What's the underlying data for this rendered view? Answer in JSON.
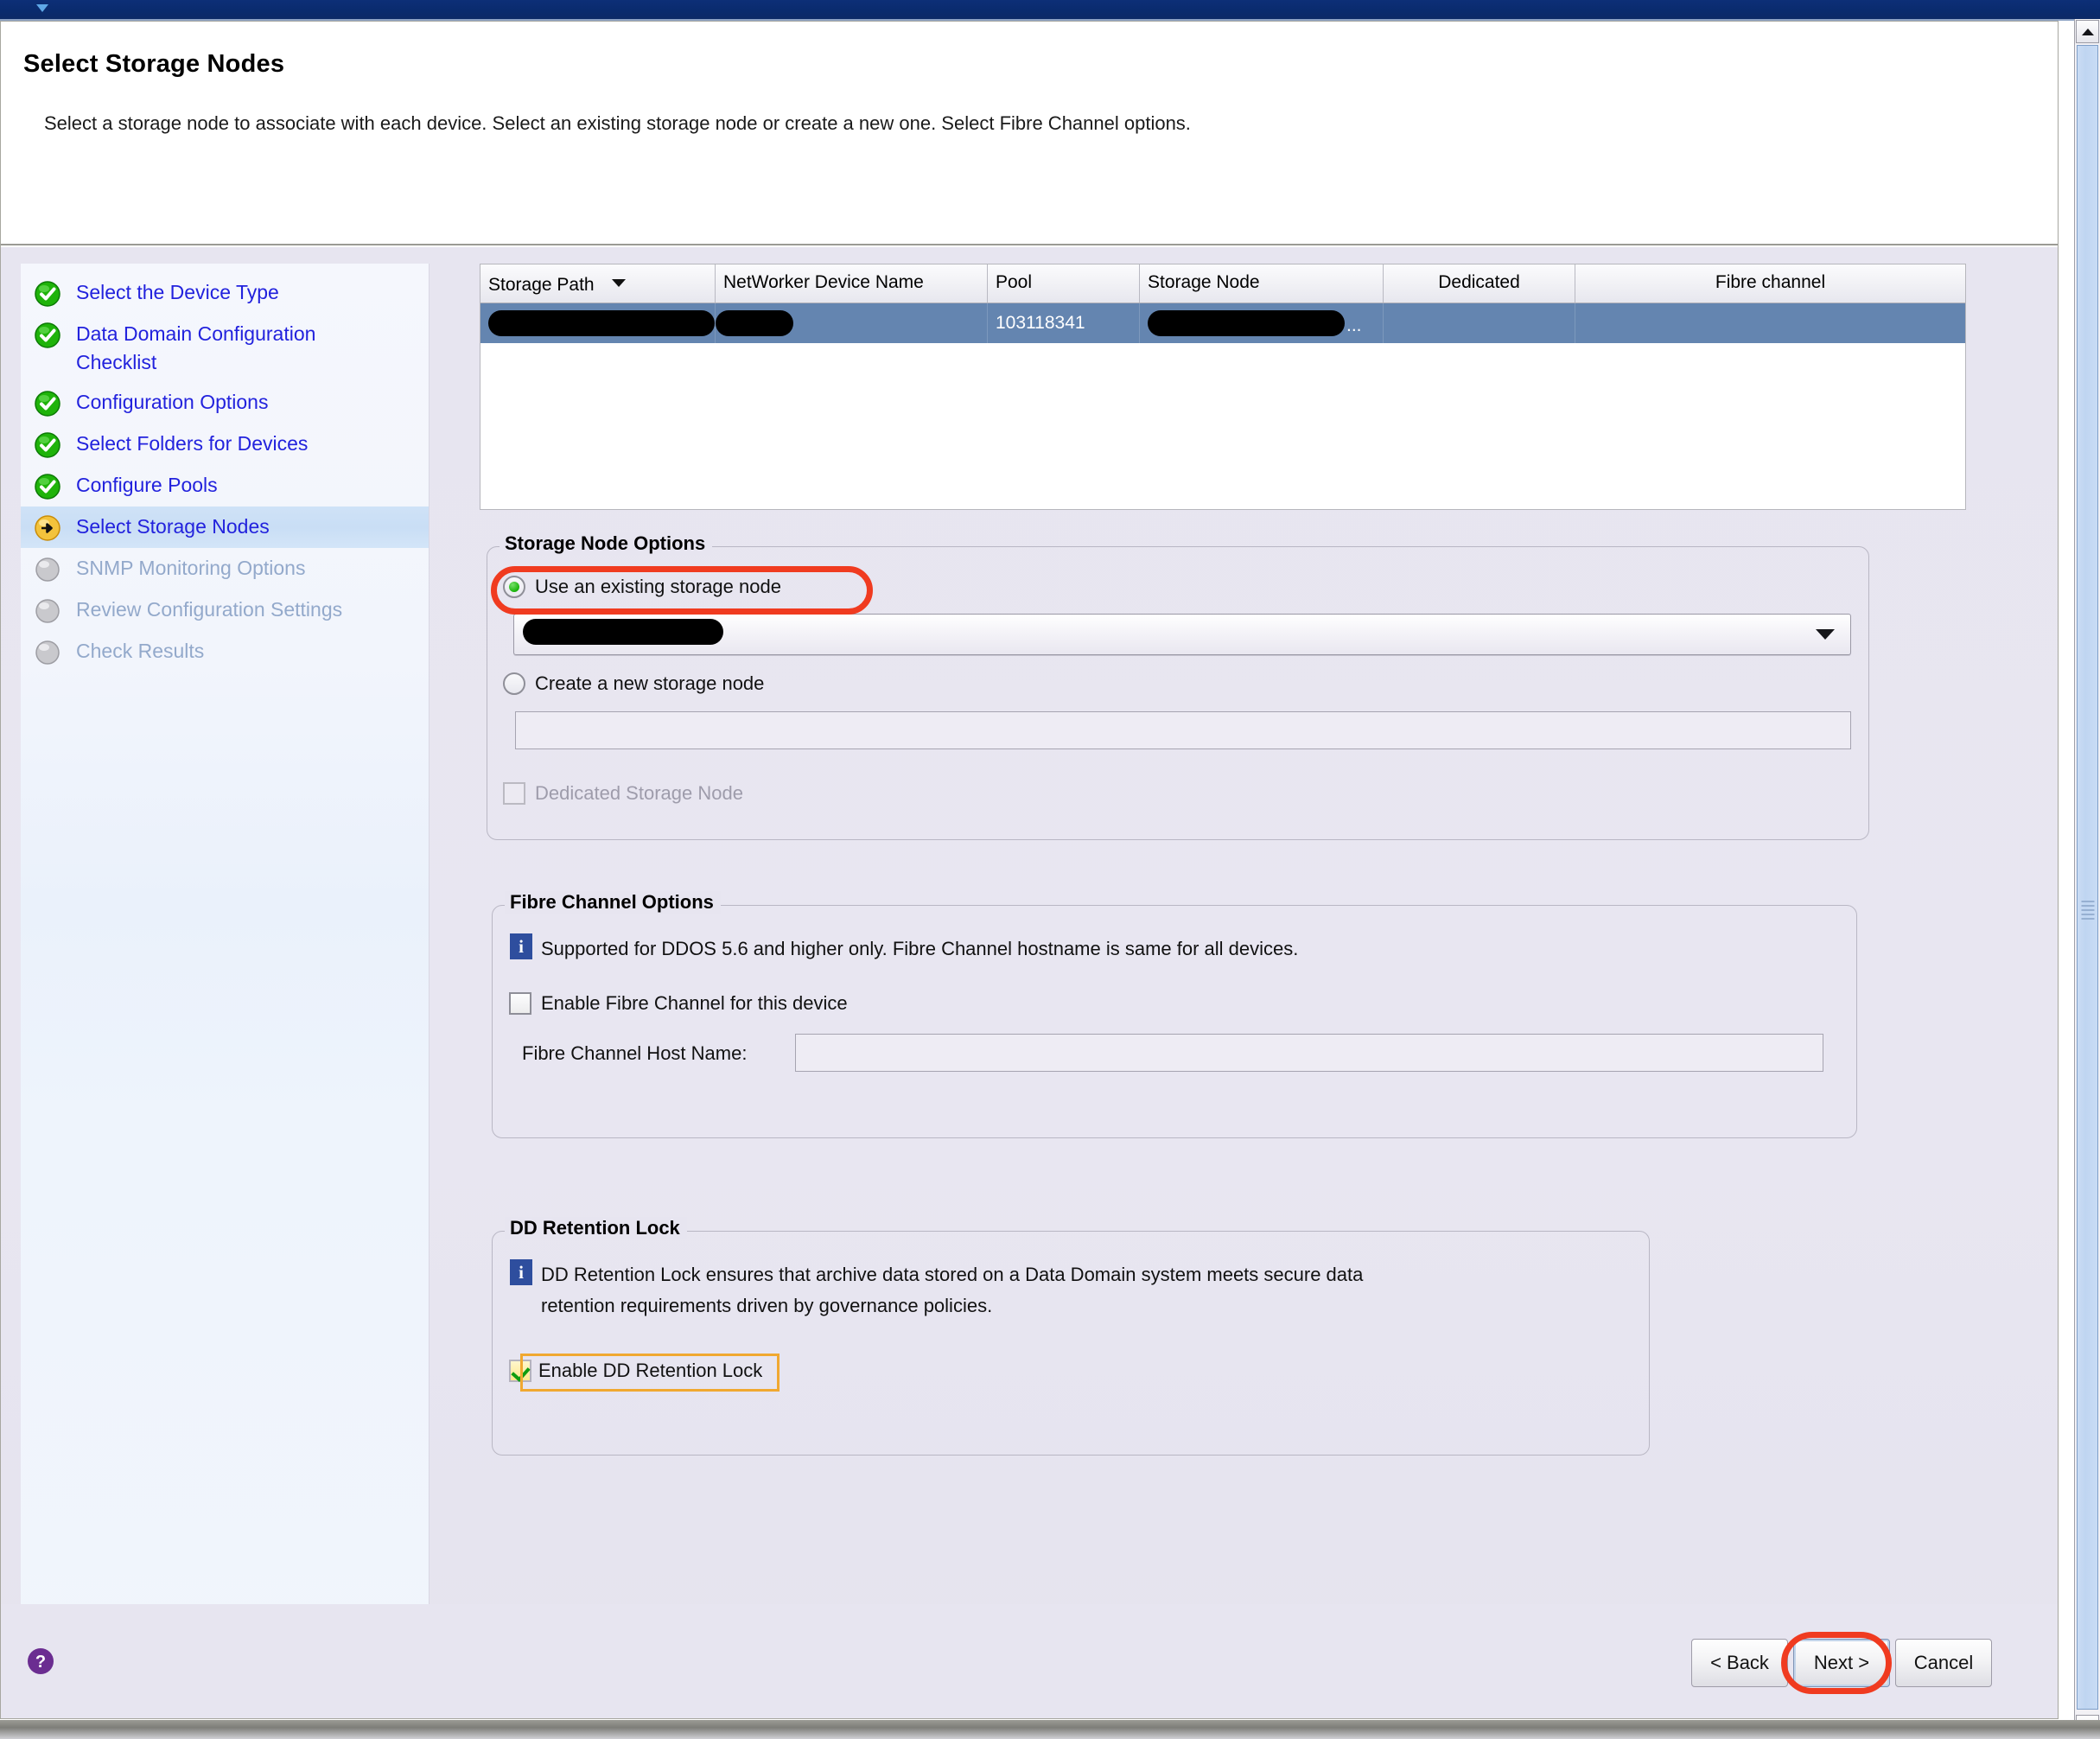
{
  "window": {
    "logo_icon": "app-logo-icon"
  },
  "header": {
    "title": "Select Storage Nodes",
    "subtitle": "Select a storage node to associate with each device. Select an existing storage node or create a new one. Select Fibre Channel options."
  },
  "sidebar": {
    "items": [
      {
        "label": "Select the Device Type",
        "state": "done",
        "icon": "green-check-icon"
      },
      {
        "label": "Data Domain Configuration\nChecklist",
        "state": "done",
        "icon": "green-check-icon"
      },
      {
        "label": "Configuration Options",
        "state": "done",
        "icon": "green-check-icon"
      },
      {
        "label": "Select Folders for Devices",
        "state": "done",
        "icon": "green-check-icon"
      },
      {
        "label": "Configure Pools",
        "state": "done",
        "icon": "green-check-icon"
      },
      {
        "label": "Select Storage Nodes",
        "state": "current",
        "icon": "orange-arrow-icon"
      },
      {
        "label": "SNMP Monitoring Options",
        "state": "pending",
        "icon": "grey-circle-icon"
      },
      {
        "label": "Review Configuration Settings",
        "state": "pending",
        "icon": "grey-circle-icon"
      },
      {
        "label": "Check Results",
        "state": "pending",
        "icon": "grey-circle-icon"
      }
    ]
  },
  "device_table": {
    "columns": [
      {
        "label": "Storage Path",
        "sorted": true,
        "sort_icon": "sort-descending-caret"
      },
      {
        "label": "NetWorker Device Name",
        "sorted": false
      },
      {
        "label": "Pool",
        "sorted": false
      },
      {
        "label": "Storage Node",
        "sorted": false
      },
      {
        "label": "Dedicated",
        "sorted": false
      },
      {
        "label": "Fibre channel",
        "sorted": false
      }
    ],
    "rows": [
      {
        "selected": true,
        "storage_path": "",
        "storage_path_redacted": true,
        "networker_device_name": "",
        "pool": "103118341",
        "storage_node": "",
        "storage_node_redacted": true,
        "storage_node_truncation": "...",
        "dedicated": "",
        "fibre_channel": ""
      }
    ]
  },
  "storage_node_options": {
    "title": "Storage Node Options",
    "use_existing": {
      "label": "Use an existing storage node",
      "checked": true,
      "highlighted": true
    },
    "existing_node_combo": {
      "value": "",
      "value_redacted": true,
      "arrow_icon": "chevron-down-icon"
    },
    "create_new": {
      "label": "Create a new storage node",
      "checked": false
    },
    "new_node_input": {
      "value": "",
      "placeholder": ""
    },
    "dedicated_storage_node": {
      "label": "Dedicated Storage Node",
      "checked": false,
      "disabled": true
    }
  },
  "fibre_channel_options": {
    "title": "Fibre Channel Options",
    "info_icon": "info-icon",
    "info_text": "Supported for DDOS 5.6 and higher only. Fibre Channel hostname is same for all devices.",
    "enable_checkbox": {
      "label": "Enable Fibre Channel for this device",
      "checked": false
    },
    "host_name_label": "Fibre Channel Host Name:",
    "host_name_input": {
      "value": "",
      "placeholder": ""
    }
  },
  "dd_retention_lock": {
    "title": "DD Retention Lock",
    "info_icon": "info-icon",
    "info_text_line1": "DD Retention Lock ensures that archive data stored on a Data Domain system meets secure data",
    "info_text_line2": "retention requirements driven by governance policies.",
    "enable_checkbox": {
      "label": "Enable DD Retention Lock",
      "checked": true,
      "highlighted": true
    }
  },
  "footer": {
    "help_icon": "help-question-icon",
    "buttons": {
      "back": "< Back",
      "next": "Next >",
      "cancel": "Cancel"
    },
    "next_highlighted": true
  },
  "scrollbar": {
    "up_icon": "scroll-up-arrow-icon",
    "down_icon": "scroll-down-arrow-icon",
    "thumb_grip": "scrollbar-grip-icon"
  },
  "colors": {
    "accent_blue": "#2222dd",
    "selected_row": "#6485b0",
    "annotation_red": "#f03b20",
    "annotation_orange": "#f0a830",
    "body_background": "#e7e5f0",
    "titlebar": "#0c2a66",
    "done_green": "#19b40b",
    "current_orange": "#f0b429",
    "help_purple": "#6b2d91"
  }
}
